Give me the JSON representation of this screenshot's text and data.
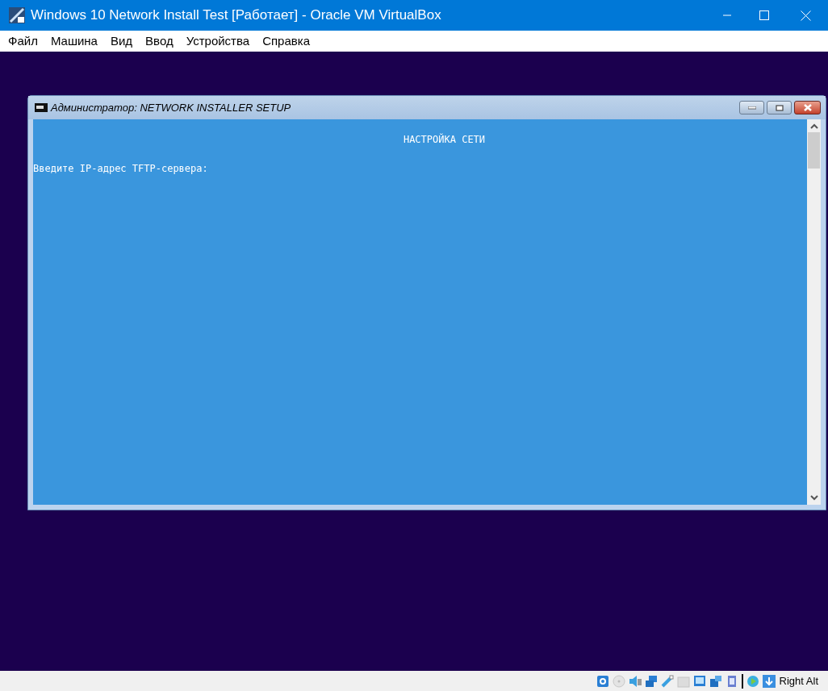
{
  "window": {
    "title": "Windows 10 Network Install Test [Работает] - Oracle VM VirtualBox"
  },
  "menu": [
    "Файл",
    "Машина",
    "Вид",
    "Ввод",
    "Устройства",
    "Справка"
  ],
  "console": {
    "title": "Администратор:  NETWORK INSTALLER SETUP",
    "heading": "НАСТРОЙКА СЕТИ",
    "prompt": "Введите IP-адрес TFTP-сервера:"
  },
  "status_bar": {
    "host_key": "Right Alt"
  }
}
